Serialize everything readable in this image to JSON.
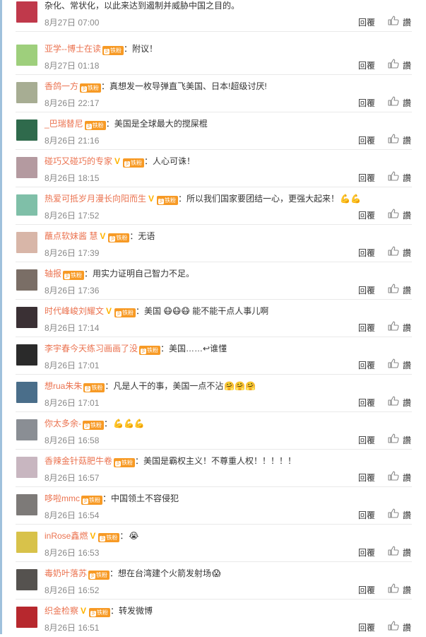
{
  "reply_label": "回覆",
  "zan_label": "讚",
  "fan_label": "铁粉",
  "fan_icon": "彡",
  "v_badge": "V",
  "separator": "：",
  "items": [
    {
      "user": "",
      "text": "杂化、常状化，以此来达到遏制并威胁中国之目的。",
      "time": "8月27日 07:00",
      "vip": false,
      "fan": false,
      "avatar_color": "#c0394b",
      "emoji": ""
    },
    {
      "user": "亚学--博士在读",
      "text": "附议！",
      "time": "8月27日 01:18",
      "vip": false,
      "fan": true,
      "avatar_color": "#9ecf7c",
      "emoji": ""
    },
    {
      "user": "香鸽一方",
      "text": "真想发一枚导弹直飞美国、日本!超级讨厌!",
      "time": "8月26日 22:17",
      "vip": false,
      "fan": true,
      "avatar_color": "#a7ad93",
      "emoji": ""
    },
    {
      "user": "_巴瑞替尼",
      "text": "美国是全球最大的搅屎棍",
      "time": "8月26日 21:16",
      "vip": false,
      "fan": true,
      "avatar_color": "#2f6a4c",
      "emoji": ""
    },
    {
      "user": "碰巧又碰巧的专家",
      "text": "人心可诛！",
      "time": "8月26日 18:15",
      "vip": true,
      "fan": true,
      "avatar_color": "#b49aa0",
      "emoji": ""
    },
    {
      "user": "热爱可抵岁月漫长向阳而生",
      "text": "所以我们国家要团结一心，更强大起来！",
      "time": "8月26日 17:52",
      "vip": true,
      "fan": true,
      "avatar_color": "#7fbfa8",
      "emoji": "💪💪"
    },
    {
      "user": "蘸点软妹酱 慧",
      "text": "无语",
      "time": "8月26日 17:39",
      "vip": true,
      "fan": true,
      "avatar_color": "#d8b6a8",
      "emoji": ""
    },
    {
      "user": "轴报",
      "text": "用实力证明自己智力不足。",
      "time": "8月26日 17:36",
      "vip": false,
      "fan": true,
      "avatar_color": "#7a6e66",
      "emoji": ""
    },
    {
      "user": "时代峰峻刘耀文",
      "text": "美国 😷😷😷 能不能干点人事儿啊",
      "time": "8月26日 17:14",
      "vip": true,
      "fan": true,
      "avatar_color": "#3a3034",
      "emoji": ""
    },
    {
      "user": "李宇春今天练习画画了没",
      "text": "美国……↩谁懂",
      "time": "8月26日 17:01",
      "vip": false,
      "fan": true,
      "avatar_color": "#2a2a2a",
      "emoji": ""
    },
    {
      "user": "想rua朱朱",
      "text": "凡是人干的事，美国一点不沾",
      "time": "8月26日 17:01",
      "vip": false,
      "fan": true,
      "avatar_color": "#4a6e8a",
      "emoji": "🤗🤗🤗"
    },
    {
      "user": "你太多余-",
      "text": "",
      "time": "8月26日 16:58",
      "vip": false,
      "fan": true,
      "avatar_color": "#8a8e94",
      "emoji": "💪💪💪"
    },
    {
      "user": "香辣金针菇肥牛卷",
      "text": "美国是霸权主义！不尊重人权！！！！！",
      "time": "8月26日 16:57",
      "vip": false,
      "fan": true,
      "avatar_color": "#c8b6c0",
      "emoji": ""
    },
    {
      "user": "哆啦mmc",
      "text": "中国领土不容侵犯",
      "time": "8月26日 16:54",
      "vip": false,
      "fan": true,
      "avatar_color": "#7d7a78",
      "emoji": ""
    },
    {
      "user": "inRose鑫燃",
      "text": "",
      "time": "8月26日 16:53",
      "vip": true,
      "fan": true,
      "avatar_color": "#d8c24a",
      "emoji": "😭"
    },
    {
      "user": "毒奶叶落苏",
      "text": "想在台湾建个火箭发射场",
      "time": "8月26日 16:52",
      "vip": false,
      "fan": true,
      "avatar_color": "#55524f",
      "emoji": "😱"
    },
    {
      "user": "织金检察",
      "text": "转发微博",
      "time": "8月26日 16:51",
      "vip": true,
      "fan": true,
      "avatar_color": "#b7282e",
      "emoji": ""
    }
  ]
}
